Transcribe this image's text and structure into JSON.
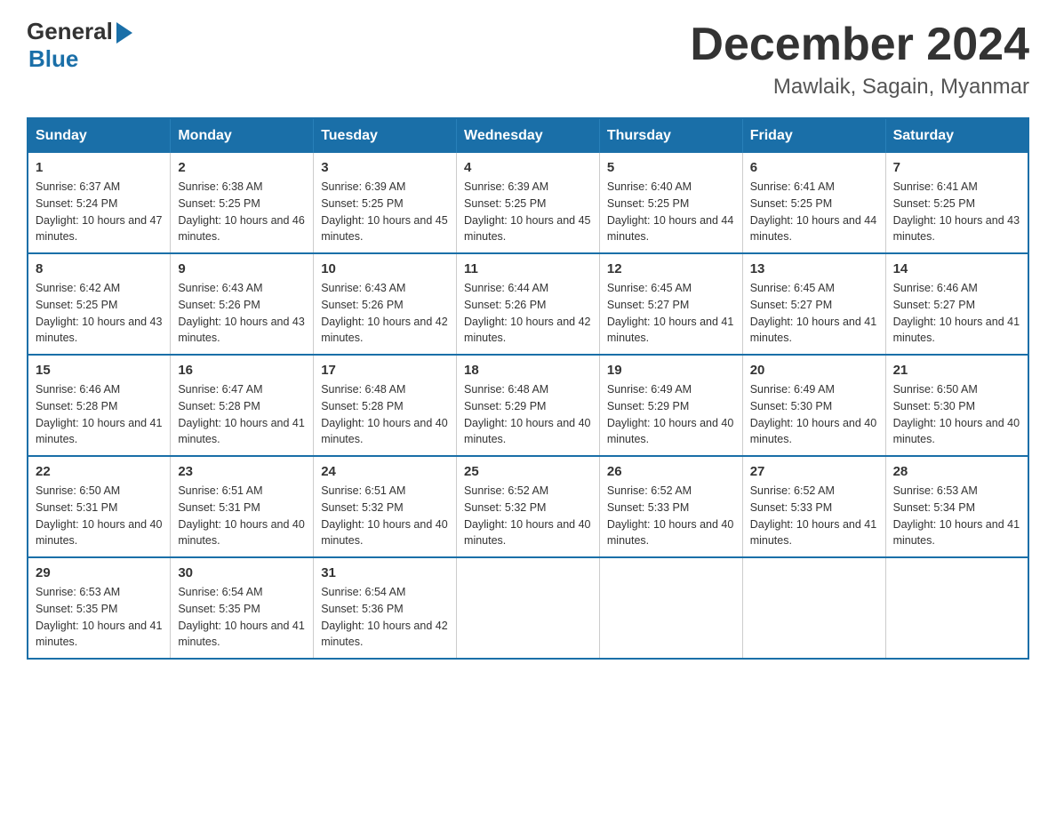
{
  "logo": {
    "general": "General",
    "arrow": "▶",
    "blue": "Blue"
  },
  "title": {
    "month": "December 2024",
    "location": "Mawlaik, Sagain, Myanmar"
  },
  "headers": [
    "Sunday",
    "Monday",
    "Tuesday",
    "Wednesday",
    "Thursday",
    "Friday",
    "Saturday"
  ],
  "weeks": [
    [
      {
        "day": "1",
        "sunrise": "6:37 AM",
        "sunset": "5:24 PM",
        "daylight": "10 hours and 47 minutes."
      },
      {
        "day": "2",
        "sunrise": "6:38 AM",
        "sunset": "5:25 PM",
        "daylight": "10 hours and 46 minutes."
      },
      {
        "day": "3",
        "sunrise": "6:39 AM",
        "sunset": "5:25 PM",
        "daylight": "10 hours and 45 minutes."
      },
      {
        "day": "4",
        "sunrise": "6:39 AM",
        "sunset": "5:25 PM",
        "daylight": "10 hours and 45 minutes."
      },
      {
        "day": "5",
        "sunrise": "6:40 AM",
        "sunset": "5:25 PM",
        "daylight": "10 hours and 44 minutes."
      },
      {
        "day": "6",
        "sunrise": "6:41 AM",
        "sunset": "5:25 PM",
        "daylight": "10 hours and 44 minutes."
      },
      {
        "day": "7",
        "sunrise": "6:41 AM",
        "sunset": "5:25 PM",
        "daylight": "10 hours and 43 minutes."
      }
    ],
    [
      {
        "day": "8",
        "sunrise": "6:42 AM",
        "sunset": "5:25 PM",
        "daylight": "10 hours and 43 minutes."
      },
      {
        "day": "9",
        "sunrise": "6:43 AM",
        "sunset": "5:26 PM",
        "daylight": "10 hours and 43 minutes."
      },
      {
        "day": "10",
        "sunrise": "6:43 AM",
        "sunset": "5:26 PM",
        "daylight": "10 hours and 42 minutes."
      },
      {
        "day": "11",
        "sunrise": "6:44 AM",
        "sunset": "5:26 PM",
        "daylight": "10 hours and 42 minutes."
      },
      {
        "day": "12",
        "sunrise": "6:45 AM",
        "sunset": "5:27 PM",
        "daylight": "10 hours and 41 minutes."
      },
      {
        "day": "13",
        "sunrise": "6:45 AM",
        "sunset": "5:27 PM",
        "daylight": "10 hours and 41 minutes."
      },
      {
        "day": "14",
        "sunrise": "6:46 AM",
        "sunset": "5:27 PM",
        "daylight": "10 hours and 41 minutes."
      }
    ],
    [
      {
        "day": "15",
        "sunrise": "6:46 AM",
        "sunset": "5:28 PM",
        "daylight": "10 hours and 41 minutes."
      },
      {
        "day": "16",
        "sunrise": "6:47 AM",
        "sunset": "5:28 PM",
        "daylight": "10 hours and 41 minutes."
      },
      {
        "day": "17",
        "sunrise": "6:48 AM",
        "sunset": "5:28 PM",
        "daylight": "10 hours and 40 minutes."
      },
      {
        "day": "18",
        "sunrise": "6:48 AM",
        "sunset": "5:29 PM",
        "daylight": "10 hours and 40 minutes."
      },
      {
        "day": "19",
        "sunrise": "6:49 AM",
        "sunset": "5:29 PM",
        "daylight": "10 hours and 40 minutes."
      },
      {
        "day": "20",
        "sunrise": "6:49 AM",
        "sunset": "5:30 PM",
        "daylight": "10 hours and 40 minutes."
      },
      {
        "day": "21",
        "sunrise": "6:50 AM",
        "sunset": "5:30 PM",
        "daylight": "10 hours and 40 minutes."
      }
    ],
    [
      {
        "day": "22",
        "sunrise": "6:50 AM",
        "sunset": "5:31 PM",
        "daylight": "10 hours and 40 minutes."
      },
      {
        "day": "23",
        "sunrise": "6:51 AM",
        "sunset": "5:31 PM",
        "daylight": "10 hours and 40 minutes."
      },
      {
        "day": "24",
        "sunrise": "6:51 AM",
        "sunset": "5:32 PM",
        "daylight": "10 hours and 40 minutes."
      },
      {
        "day": "25",
        "sunrise": "6:52 AM",
        "sunset": "5:32 PM",
        "daylight": "10 hours and 40 minutes."
      },
      {
        "day": "26",
        "sunrise": "6:52 AM",
        "sunset": "5:33 PM",
        "daylight": "10 hours and 40 minutes."
      },
      {
        "day": "27",
        "sunrise": "6:52 AM",
        "sunset": "5:33 PM",
        "daylight": "10 hours and 41 minutes."
      },
      {
        "day": "28",
        "sunrise": "6:53 AM",
        "sunset": "5:34 PM",
        "daylight": "10 hours and 41 minutes."
      }
    ],
    [
      {
        "day": "29",
        "sunrise": "6:53 AM",
        "sunset": "5:35 PM",
        "daylight": "10 hours and 41 minutes."
      },
      {
        "day": "30",
        "sunrise": "6:54 AM",
        "sunset": "5:35 PM",
        "daylight": "10 hours and 41 minutes."
      },
      {
        "day": "31",
        "sunrise": "6:54 AM",
        "sunset": "5:36 PM",
        "daylight": "10 hours and 42 minutes."
      },
      null,
      null,
      null,
      null
    ]
  ]
}
